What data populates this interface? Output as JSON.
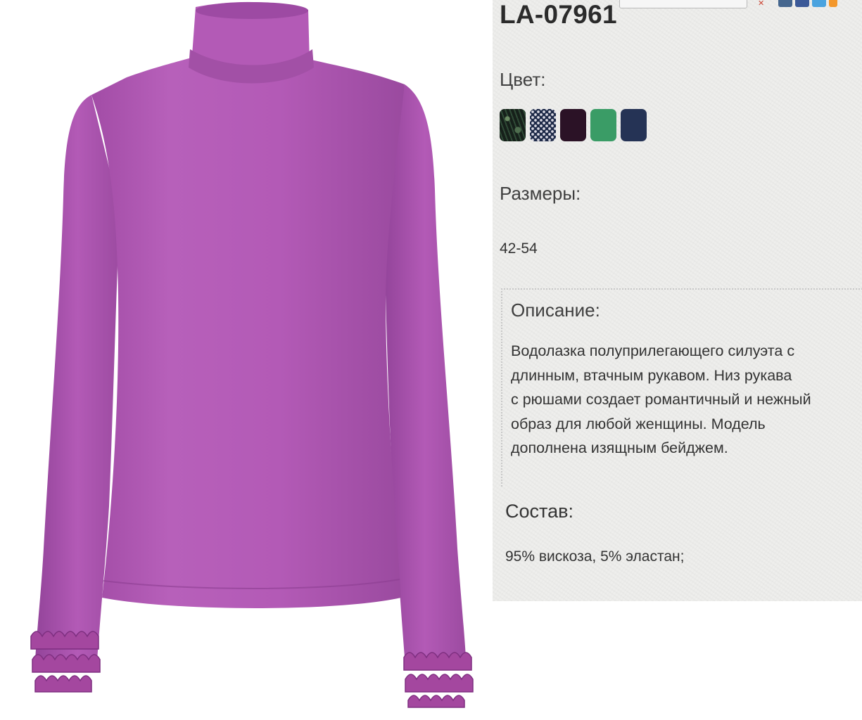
{
  "product": {
    "article": "LA-07961",
    "image_alt": "purple-turtleneck-with-ruffled-cuffs"
  },
  "color": {
    "label": "Цвет:",
    "swatches": [
      {
        "name": "dark-green-print",
        "hex": "#1f3326"
      },
      {
        "name": "navy-polka-dot",
        "hex": "#1e2a48"
      },
      {
        "name": "dark-plum",
        "hex": "#2b1226"
      },
      {
        "name": "green",
        "hex": "#3a9c66"
      },
      {
        "name": "navy",
        "hex": "#253355"
      }
    ]
  },
  "sizes": {
    "label": "Размеры:",
    "value": "42-54"
  },
  "description": {
    "title": "Описание:",
    "text": "Водолазка полуприлегающего силуэта с\nдлинным, втачным  рукавом. Низ рукава\nс  рюшами создает романтичный и нежный\nобраз для любой женщины.  Модель\nдополнена изящным  бейджем."
  },
  "composition": {
    "title": "Состав:",
    "value": "95% вискоза, 5% эластан;"
  },
  "colors": {
    "garment": "#b35ab6",
    "garment_shadow": "#9a4a9f",
    "ruffle": "#a4479f",
    "panel_bg": "#eeeeec"
  }
}
